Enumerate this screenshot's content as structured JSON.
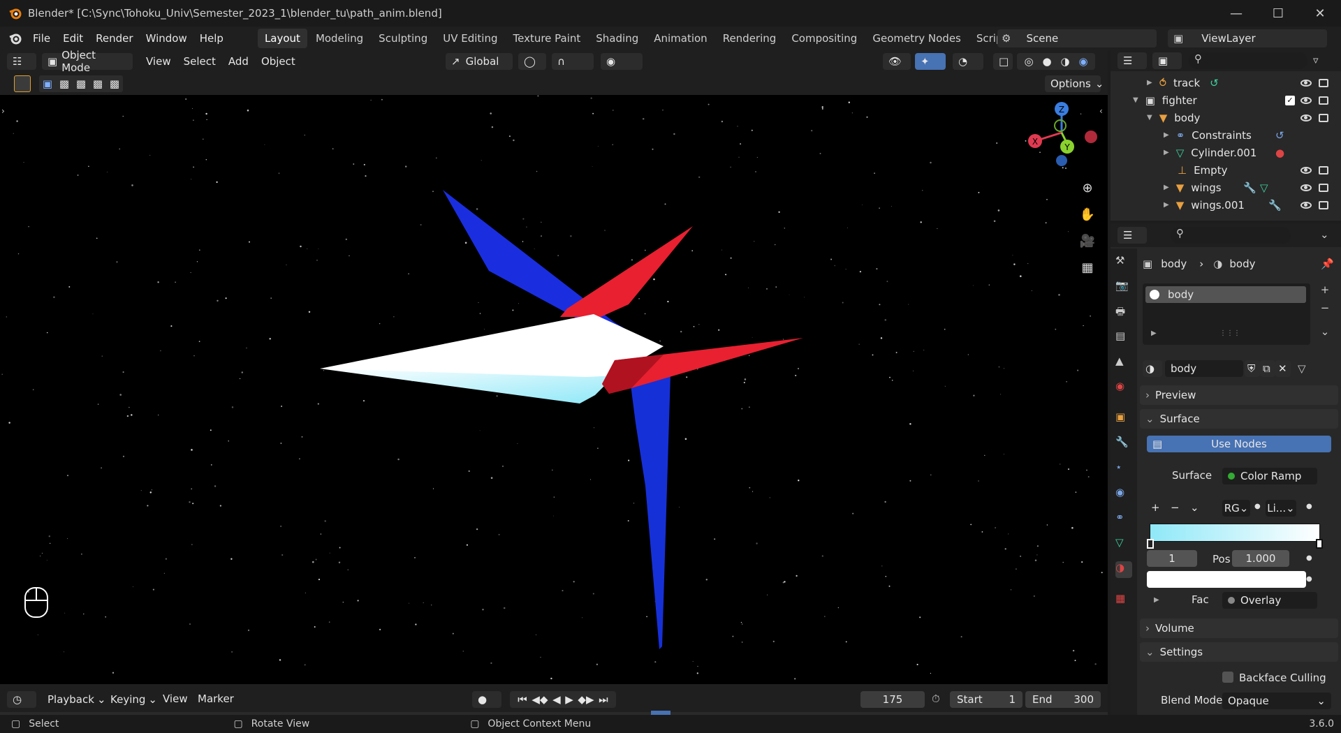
{
  "window": {
    "title": "Blender* [C:\\Sync\\Tohoku_Univ\\Semester_2023_1\\blender_tu\\path_anim.blend]"
  },
  "menu": {
    "items": [
      "File",
      "Edit",
      "Render",
      "Window",
      "Help"
    ]
  },
  "workspaces": {
    "tabs": [
      "Layout",
      "Modeling",
      "Sculpting",
      "UV Editing",
      "Texture Paint",
      "Shading",
      "Animation",
      "Rendering",
      "Compositing",
      "Geometry Nodes",
      "Scripting"
    ],
    "active": "Layout"
  },
  "scene": {
    "name": "Scene",
    "view_layer": "ViewLayer"
  },
  "viewport_header": {
    "mode": "Object Mode",
    "menus": [
      "View",
      "Select",
      "Add",
      "Object"
    ],
    "orientation": "Global",
    "options_label": "Options"
  },
  "gizmo": {
    "z": "Z",
    "y": "Y",
    "x": "X"
  },
  "outliner": {
    "rows": [
      {
        "label": "track",
        "icon": "curve-icon"
      },
      {
        "label": "fighter",
        "icon": "collection-icon"
      },
      {
        "label": "body",
        "icon": "mesh-object-icon"
      },
      {
        "label": "Constraints",
        "icon": "constraint-icon"
      },
      {
        "label": "Cylinder.001",
        "icon": "mesh-data-icon"
      },
      {
        "label": "Empty",
        "icon": "empty-icon"
      },
      {
        "label": "wings",
        "icon": "mesh-object-icon"
      },
      {
        "label": "wings.001",
        "icon": "mesh-object-icon"
      }
    ]
  },
  "properties": {
    "breadcrumb": [
      "body",
      "body"
    ],
    "material_slot": "body",
    "material_name": "body",
    "panels": {
      "preview": "Preview",
      "surface": "Surface",
      "volume": "Volume",
      "settings": "Settings"
    },
    "use_nodes": "Use Nodes",
    "surface_label": "Surface",
    "surface_value": "Color Ramp",
    "color_mode": "RG",
    "interpolation": "Li...",
    "stop_index": "1",
    "pos_label": "Pos",
    "pos_value": "1.000",
    "fac_label": "Fac",
    "fac_value": "Overlay",
    "backface_culling": "Backface Culling",
    "blend_mode_label": "Blend Mode",
    "blend_mode_value": "Opaque",
    "ramp_colors": [
      "#8fe8f8",
      "#ffffff"
    ]
  },
  "timeline": {
    "menus": [
      "Playback",
      "Keying",
      "View",
      "Marker"
    ],
    "current_frame": "175",
    "start_label": "Start",
    "start": "1",
    "end_label": "End",
    "end": "300"
  },
  "statusbar": {
    "select": "Select",
    "rotate": "Rotate View",
    "context": "Object Context Menu",
    "version": "3.6.0"
  },
  "colors": {
    "accent": "#4772b3",
    "red_part": "#e82030",
    "blue_part": "#1a2ee0",
    "white_part": "#ffffff",
    "cyan_part": "#9ee8f5"
  }
}
